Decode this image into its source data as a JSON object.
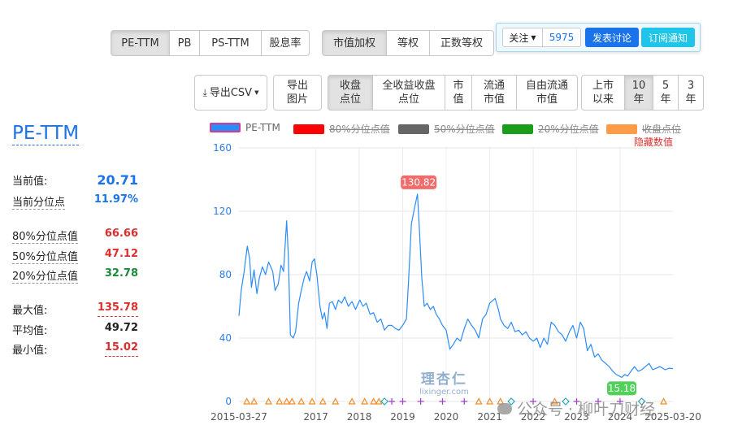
{
  "metric_tabs": [
    {
      "label": "PE-TTM",
      "active": true
    },
    {
      "label": "PB",
      "active": false
    },
    {
      "label": "PS-TTM",
      "active": false
    },
    {
      "label": "股息率",
      "active": false
    }
  ],
  "weight_tabs": [
    {
      "label": "市值加权",
      "active": true
    },
    {
      "label": "等权",
      "active": false
    },
    {
      "label": "正数等权",
      "active": false
    }
  ],
  "follow": {
    "label": "关注",
    "count": "5975",
    "discuss_label": "发表讨论",
    "subscribe_label": "订阅通知"
  },
  "export": {
    "csv_label": "导出CSV",
    "image_label": "导出图片"
  },
  "price_tabs": [
    {
      "label": "收盘点位",
      "active": true
    },
    {
      "label": "全收益收盘点位",
      "active": false
    },
    {
      "label": "市值",
      "active": false
    },
    {
      "label": "流通市值",
      "active": false
    },
    {
      "label": "自由流通市值",
      "active": false
    }
  ],
  "range_tabs": [
    {
      "label": "上市以来",
      "active": false
    },
    {
      "label": "10年",
      "active": true
    },
    {
      "label": "5年",
      "active": false
    },
    {
      "label": "3年",
      "active": false
    }
  ],
  "stats": {
    "title": "PE-TTM",
    "current_label": "当前值:",
    "current_value": "20.71",
    "current_pct_label": "当前分位点",
    "current_pct_value": "11.97%",
    "p80_label": "80%分位点值",
    "p80_value": "66.66",
    "p50_label": "50%分位点值",
    "p50_value": "47.12",
    "p20_label": "20%分位点值",
    "p20_value": "32.78",
    "max_label": "最大值:",
    "max_value": "135.78",
    "avg_label": "平均值:",
    "avg_value": "49.72",
    "min_label": "最小值:",
    "min_value": "15.02"
  },
  "legend": {
    "items": [
      {
        "label": "PE-TTM",
        "color": "#2b8cf6",
        "hidden": false
      },
      {
        "label": "80%分位点值",
        "color": "#ff0000",
        "hidden": true
      },
      {
        "label": "50%分位点值",
        "color": "#666666",
        "hidden": true
      },
      {
        "label": "20%分位点值",
        "color": "#1a9e1a",
        "hidden": true
      },
      {
        "label": "收盘点位",
        "color": "#ff9b47",
        "hidden": true
      }
    ],
    "hide_values_label": "隐藏数值"
  },
  "watermark": {
    "brand": "理杏仁",
    "url": "lixinger.com",
    "wechat": "公众号 · 柳叶刀财经"
  },
  "colors": {
    "line": "#2b8cf6",
    "accent": "#1a73e8",
    "red": "#d9302f",
    "green": "#1a8a3a",
    "peak_label": "#f26b6b",
    "low_label": "#4fd15a"
  },
  "chart_data": {
    "type": "line",
    "x_start": "2015-03-27",
    "x_end": "2025-03-20",
    "x_tick_labels": [
      "2015-03-27",
      "2017",
      "2018",
      "2019",
      "2020",
      "2021",
      "2022",
      "2023",
      "2024",
      "2025-03-20"
    ],
    "ylim": [
      0,
      160
    ],
    "y_ticks": [
      0,
      40,
      80,
      120,
      160
    ],
    "grid": true,
    "annotations": [
      {
        "label": "130.82",
        "x": "2019-05",
        "y": 130.82,
        "kind": "max"
      },
      {
        "label": "15.18",
        "x": "2024-01",
        "y": 15.18,
        "kind": "min"
      }
    ],
    "series": [
      {
        "name": "PE-TTM",
        "points": [
          [
            "2015-03-27",
            54
          ],
          [
            "2015-04-15",
            70
          ],
          [
            "2015-05-10",
            82
          ],
          [
            "2015-06-05",
            98
          ],
          [
            "2015-06-25",
            90
          ],
          [
            "2015-07-10",
            72
          ],
          [
            "2015-08-01",
            83
          ],
          [
            "2015-08-25",
            68
          ],
          [
            "2015-09-15",
            78
          ],
          [
            "2015-10-10",
            85
          ],
          [
            "2015-11-05",
            80
          ],
          [
            "2015-12-01",
            88
          ],
          [
            "2016-01-05",
            82
          ],
          [
            "2016-01-25",
            70
          ],
          [
            "2016-02-20",
            74
          ],
          [
            "2016-03-15",
            86
          ],
          [
            "2016-04-05",
            82
          ],
          [
            "2016-05-01",
            114
          ],
          [
            "2016-05-15",
            92
          ],
          [
            "2016-06-01",
            42
          ],
          [
            "2016-06-25",
            40
          ],
          [
            "2016-07-15",
            44
          ],
          [
            "2016-08-10",
            62
          ],
          [
            "2016-09-01",
            70
          ],
          [
            "2016-09-25",
            78
          ],
          [
            "2016-10-15",
            82
          ],
          [
            "2016-11-10",
            76
          ],
          [
            "2016-12-01",
            88
          ],
          [
            "2016-12-20",
            90
          ],
          [
            "2017-01-10",
            80
          ],
          [
            "2017-02-05",
            60
          ],
          [
            "2017-02-25",
            52
          ],
          [
            "2017-03-15",
            56
          ],
          [
            "2017-04-05",
            46
          ],
          [
            "2017-04-25",
            62
          ],
          [
            "2017-05-20",
            63
          ],
          [
            "2017-06-15",
            58
          ],
          [
            "2017-07-10",
            64
          ],
          [
            "2017-08-05",
            62
          ],
          [
            "2017-09-01",
            66
          ],
          [
            "2017-10-01",
            60
          ],
          [
            "2017-11-01",
            63
          ],
          [
            "2017-12-01",
            58
          ],
          [
            "2018-01-05",
            64
          ],
          [
            "2018-02-01",
            60
          ],
          [
            "2018-03-01",
            62
          ],
          [
            "2018-04-01",
            55
          ],
          [
            "2018-05-01",
            56
          ],
          [
            "2018-06-01",
            50
          ],
          [
            "2018-07-01",
            52
          ],
          [
            "2018-08-01",
            45
          ],
          [
            "2018-09-01",
            48
          ],
          [
            "2018-10-01",
            48
          ],
          [
            "2018-11-01",
            46
          ],
          [
            "2018-12-01",
            45
          ],
          [
            "2019-01-01",
            48
          ],
          [
            "2019-02-01",
            52
          ],
          [
            "2019-02-20",
            78
          ],
          [
            "2019-03-15",
            112
          ],
          [
            "2019-04-10",
            122
          ],
          [
            "2019-05-05",
            130.82
          ],
          [
            "2019-05-20",
            110
          ],
          [
            "2019-06-10",
            78
          ],
          [
            "2019-07-01",
            60
          ],
          [
            "2019-07-25",
            62
          ],
          [
            "2019-08-20",
            58
          ],
          [
            "2019-09-15",
            60
          ],
          [
            "2019-10-10",
            55
          ],
          [
            "2019-11-05",
            52
          ],
          [
            "2019-12-01",
            48
          ],
          [
            "2020-01-01",
            45
          ],
          [
            "2020-02-01",
            33
          ],
          [
            "2020-03-01",
            36
          ],
          [
            "2020-04-01",
            40
          ],
          [
            "2020-05-01",
            38
          ],
          [
            "2020-06-01",
            46
          ],
          [
            "2020-07-01",
            52
          ],
          [
            "2020-08-01",
            48
          ],
          [
            "2020-09-01",
            45
          ],
          [
            "2020-10-01",
            40
          ],
          [
            "2020-11-01",
            52
          ],
          [
            "2020-12-01",
            55
          ],
          [
            "2021-01-01",
            62
          ],
          [
            "2021-02-15",
            65
          ],
          [
            "2021-03-15",
            58
          ],
          [
            "2021-04-01",
            52
          ],
          [
            "2021-05-01",
            48
          ],
          [
            "2021-06-01",
            46
          ],
          [
            "2021-07-01",
            50
          ],
          [
            "2021-08-01",
            44
          ],
          [
            "2021-09-01",
            45
          ],
          [
            "2021-10-01",
            42
          ],
          [
            "2021-11-01",
            44
          ],
          [
            "2021-12-01",
            40
          ],
          [
            "2022-01-01",
            38
          ],
          [
            "2022-02-01",
            40
          ],
          [
            "2022-03-01",
            34
          ],
          [
            "2022-04-01",
            40
          ],
          [
            "2022-05-01",
            36
          ],
          [
            "2022-06-01",
            50
          ],
          [
            "2022-07-01",
            48
          ],
          [
            "2022-08-01",
            44
          ],
          [
            "2022-09-01",
            42
          ],
          [
            "2022-10-01",
            38
          ],
          [
            "2022-11-01",
            44
          ],
          [
            "2022-12-01",
            48
          ],
          [
            "2023-01-01",
            40
          ],
          [
            "2023-02-01",
            50
          ],
          [
            "2023-03-01",
            46
          ],
          [
            "2023-04-01",
            32
          ],
          [
            "2023-05-01",
            36
          ],
          [
            "2023-06-01",
            28
          ],
          [
            "2023-07-01",
            30
          ],
          [
            "2023-08-01",
            26
          ],
          [
            "2023-09-01",
            24
          ],
          [
            "2023-10-01",
            22
          ],
          [
            "2023-11-01",
            19
          ],
          [
            "2023-12-01",
            17
          ],
          [
            "2024-01-15",
            15.18
          ],
          [
            "2024-02-10",
            17
          ],
          [
            "2024-03-05",
            16
          ],
          [
            "2024-04-01",
            19
          ],
          [
            "2024-05-01",
            22
          ],
          [
            "2024-06-01",
            19
          ],
          [
            "2024-07-01",
            20
          ],
          [
            "2024-08-01",
            22
          ],
          [
            "2024-09-01",
            24
          ],
          [
            "2024-10-01",
            20
          ],
          [
            "2024-11-01",
            21
          ],
          [
            "2024-12-01",
            22
          ],
          [
            "2025-01-15",
            20
          ],
          [
            "2025-02-15",
            21
          ],
          [
            "2025-03-20",
            20.71
          ]
        ]
      }
    ],
    "event_markers": [
      {
        "x": "2015-06-01",
        "shape": "triangle"
      },
      {
        "x": "2015-08-01",
        "shape": "triangle"
      },
      {
        "x": "2015-12-01",
        "shape": "triangle"
      },
      {
        "x": "2016-03-01",
        "shape": "triangle"
      },
      {
        "x": "2016-05-01",
        "shape": "triangle"
      },
      {
        "x": "2016-06-15",
        "shape": "triangle"
      },
      {
        "x": "2016-09-01",
        "shape": "triangle"
      },
      {
        "x": "2016-12-01",
        "shape": "triangle"
      },
      {
        "x": "2017-03-01",
        "shape": "triangle"
      },
      {
        "x": "2017-06-15",
        "shape": "triangle"
      },
      {
        "x": "2017-11-01",
        "shape": "triangle"
      },
      {
        "x": "2018-02-15",
        "shape": "triangle"
      },
      {
        "x": "2018-05-01",
        "shape": "triangle"
      },
      {
        "x": "2018-06-15",
        "shape": "triangle"
      },
      {
        "x": "2018-08-01",
        "shape": "diamond"
      },
      {
        "x": "2018-10-01",
        "shape": "plus"
      },
      {
        "x": "2019-01-01",
        "shape": "plus"
      },
      {
        "x": "2019-06-01",
        "shape": "plus"
      },
      {
        "x": "2019-12-01",
        "shape": "plus"
      },
      {
        "x": "2020-06-01",
        "shape": "plus"
      },
      {
        "x": "2020-10-01",
        "shape": "triangle"
      },
      {
        "x": "2021-01-01",
        "shape": "triangle"
      },
      {
        "x": "2021-04-01",
        "shape": "triangle"
      },
      {
        "x": "2021-07-01",
        "shape": "diamond"
      },
      {
        "x": "2022-01-01",
        "shape": "plus"
      },
      {
        "x": "2022-07-01",
        "shape": "triangle"
      },
      {
        "x": "2022-10-01",
        "shape": "diamond"
      },
      {
        "x": "2023-01-01",
        "shape": "plus"
      },
      {
        "x": "2023-07-01",
        "shape": "plus"
      },
      {
        "x": "2024-01-01",
        "shape": "plus"
      },
      {
        "x": "2024-07-01",
        "shape": "diamond"
      },
      {
        "x": "2025-01-01",
        "shape": "triangle"
      }
    ]
  }
}
